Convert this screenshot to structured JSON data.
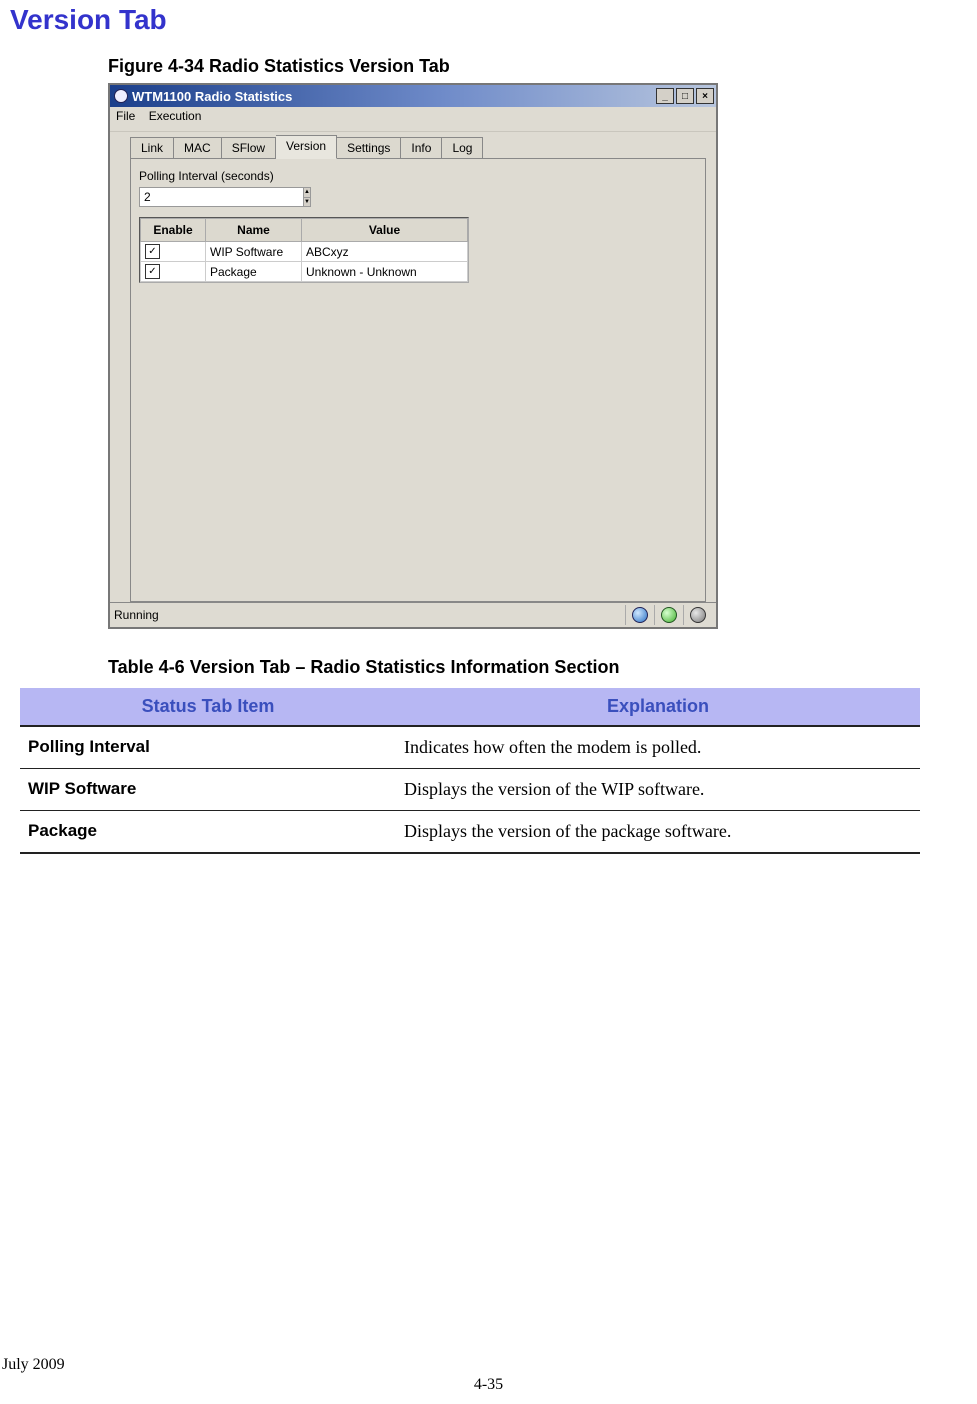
{
  "heading": "Version Tab",
  "figure_caption": "Figure 4-34      Radio Statistics Version Tab",
  "window": {
    "title": "WTM1100 Radio Statistics",
    "menus": [
      "File",
      "Execution"
    ],
    "tabs": [
      "Link",
      "MAC",
      "SFlow",
      "Version",
      "Settings",
      "Info",
      "Log"
    ],
    "active_tab_index": 3,
    "polling_label": "Polling Interval (seconds)",
    "polling_value": "2",
    "columns": [
      "Enable",
      "Name",
      "Value"
    ],
    "rows": [
      {
        "enabled": true,
        "name": "WIP Software",
        "value": "ABCxyz"
      },
      {
        "enabled": true,
        "name": "Package",
        "value": "Unknown - Unknown"
      }
    ],
    "status_text": "Running"
  },
  "table_caption": "Table 4-6    Version Tab – Radio Statistics Information Section",
  "doc_table": {
    "headers": [
      "Status Tab Item",
      "Explanation"
    ],
    "rows": [
      {
        "item": "Polling Interval",
        "explanation": "Indicates how often the modem is polled."
      },
      {
        "item": "WIP Software",
        "explanation": "Displays the version of the WIP software."
      },
      {
        "item": "Package",
        "explanation": "Displays the version of the package software."
      }
    ]
  },
  "footer_date": "July 2009",
  "page_number": "4-35",
  "glyphs": {
    "min": "_",
    "max": "□",
    "close": "×",
    "up": "▲",
    "down": "▼",
    "check": "✓"
  }
}
